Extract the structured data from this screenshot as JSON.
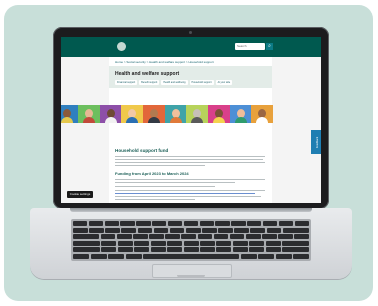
{
  "browser": {
    "search_placeholder": "Search",
    "search_icon": "magnifier-icon"
  },
  "site": {
    "breadcrumb": "Home > Social security > Health and welfare support > Household support",
    "page_title": "Health and welfare support",
    "subnav": [
      "Financial support",
      "Benefit support",
      "Health and wellbeing",
      "Household support",
      "At your side"
    ],
    "heading": "Household support fund",
    "section_heading": "Funding from April 2023 to March 2024",
    "feedback_label": "Feedback",
    "chip_label": "Cookie settings"
  },
  "colors": {
    "brand": "#00594f",
    "accent": "#1b5f57",
    "feedback": "#1f7eb2"
  }
}
